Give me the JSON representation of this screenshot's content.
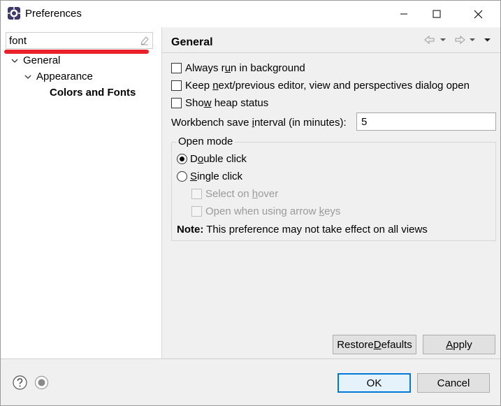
{
  "window": {
    "title": "Preferences"
  },
  "filter": {
    "value": "font"
  },
  "tree": {
    "general": "General",
    "appearance": "Appearance",
    "colors_fonts": "Colors and Fonts"
  },
  "page": {
    "title": "General",
    "options": {
      "run_bg_pre": "Always r",
      "run_bg_key": "u",
      "run_bg_post": "n in background",
      "keep_pre": "Keep ",
      "keep_key": "n",
      "keep_post": "ext/previous editor, view and perspectives dialog open",
      "heap_pre": "Sho",
      "heap_key": "w",
      "heap_post": " heap status"
    },
    "save_interval": {
      "label_pre": "Workbench save ",
      "label_key": "i",
      "label_post": "nterval (in minutes):",
      "value": "5"
    },
    "open_mode": {
      "title": "Open mode",
      "double_pre": "D",
      "double_key": "o",
      "double_post": "uble click",
      "single_pre": "",
      "single_key": "S",
      "single_post": "ingle click",
      "hover_pre": "Select on ",
      "hover_key": "h",
      "hover_post": "over",
      "arrow_pre": "Open when using arrow ",
      "arrow_key": "k",
      "arrow_post": "eys",
      "note_bold": "Note:",
      "note_text": " This preference may not take effect on all views"
    },
    "restore_pre": "Restore ",
    "restore_key": "D",
    "restore_post": "efaults",
    "apply_pre": "",
    "apply_key": "A",
    "apply_post": "pply"
  },
  "footer": {
    "ok": "OK",
    "cancel": "Cancel"
  },
  "colors": {
    "accent": "#0078d7",
    "highlight": "#e8212a"
  }
}
